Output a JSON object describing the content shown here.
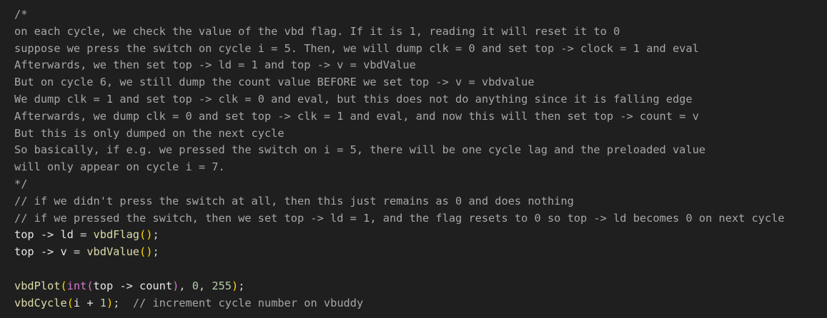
{
  "editor": {
    "comment_block": [
      "/*",
      "on each cycle, we check the value of the vbd flag. If it is 1, reading it will reset it to 0",
      "suppose we press the switch on cycle i = 5. Then, we will dump clk = 0 and set top -> clock = 1 and eval",
      "Afterwards, we then set top -> ld = 1 and top -> v = vbdValue",
      "But on cycle 6, we still dump the count value BEFORE we set top -> v = vbdvalue",
      "We dump clk = 1 and set top -> clk = 0 and eval, but this does not do anything since it is falling edge",
      "Afterwards, we dump clk = 0 and set top -> clk = 1 and eval, and now this will then set top -> count = v",
      "But this is only dumped on the next cycle",
      "So basically, if e.g. we pressed the switch on i = 5, there will be one cycle lag and the preloaded value",
      "will only appear on cycle i = 7.",
      "*/"
    ],
    "line_comments": [
      "// if we didn't press the switch at all, then this just remains as 0 and does nothing",
      "// if we pressed the switch, then we set top -> ld = 1, and the flag resets to 0 so top -> ld becomes 0 on next cycle"
    ],
    "code": {
      "ld_assign": {
        "lhs": "top -> ld",
        "eq": " = ",
        "func": "vbdFlag",
        "open": "(",
        "close": ")",
        "end": ";"
      },
      "v_assign": {
        "lhs": "top -> v",
        "eq": " = ",
        "func": "vbdValue",
        "open": "(",
        "close": ")",
        "end": ";"
      },
      "plot_call": {
        "func": "vbdPlot",
        "open": "(",
        "cast": "int",
        "cast_open": "(",
        "arg": "top -> count",
        "cast_close": ")",
        "sep1": ", ",
        "n1": "0",
        "sep2": ", ",
        "n2": "255",
        "close": ")",
        "end": ";"
      },
      "cycle_call": {
        "func": "vbdCycle",
        "open": "(",
        "arg": "i + ",
        "n": "1",
        "close": ")",
        "end": ";  ",
        "comment": "// increment cycle number on vbuddy"
      }
    }
  }
}
